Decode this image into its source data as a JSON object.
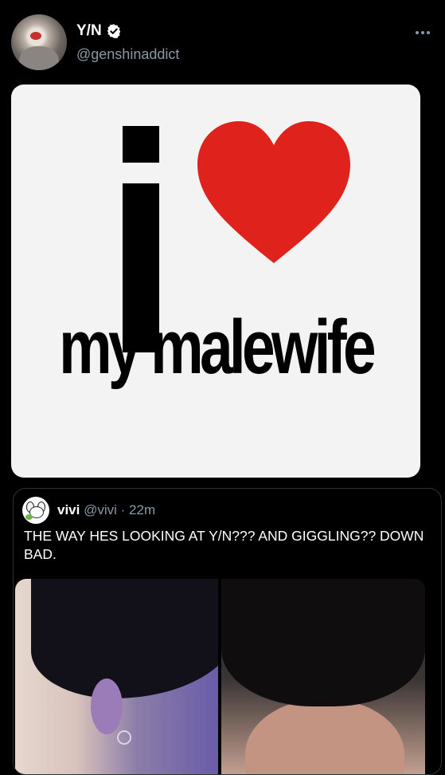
{
  "tweet": {
    "display_name": "Y/N",
    "handle": "@genshinaddict",
    "image": {
      "meme_text": "my malewife"
    }
  },
  "quote": {
    "name": "vivi",
    "handle": "@vivi",
    "separator": "·",
    "time": "22m",
    "text": "THE WAY HES LOOKING AT Y/N??? AND GIGGLING?? DOWN BAD."
  },
  "colors": {
    "background": "#000000",
    "text_primary": "#ffffff",
    "text_secondary": "#8b98a5",
    "border": "#2f3336",
    "heart": "#e0221c"
  },
  "icons": {
    "verified": "verified-badge-icon",
    "more": "more-horizontal-icon",
    "heart": "heart-icon"
  }
}
